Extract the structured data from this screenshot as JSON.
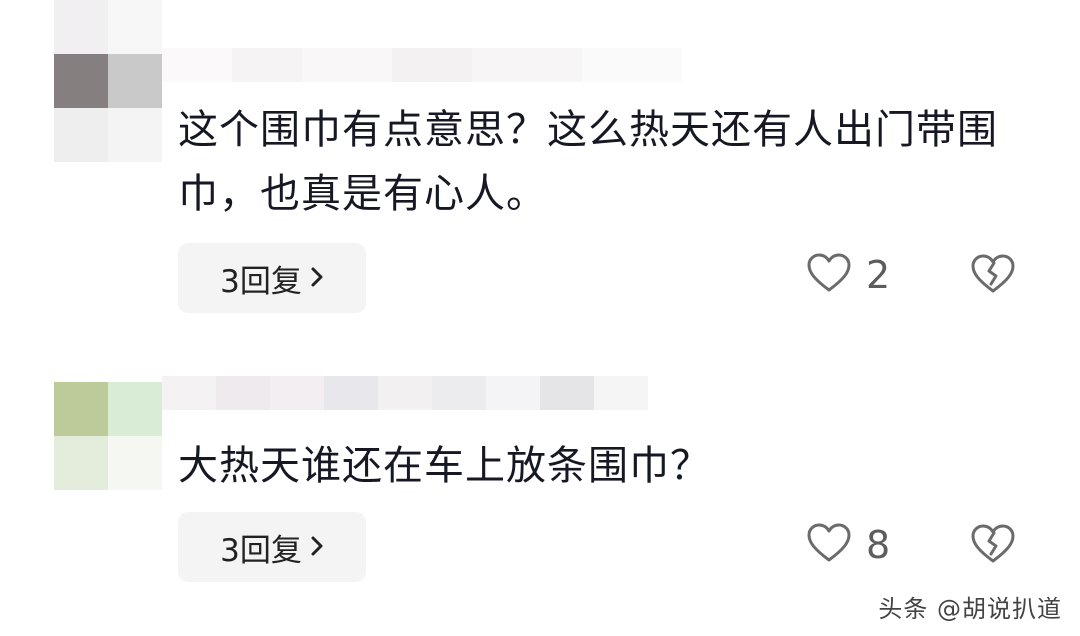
{
  "comments": [
    {
      "text": "这个围巾有点意思？这么热天还有人出门带围巾，也真是有心人。",
      "reply_label": "3回复",
      "like_count": "2"
    },
    {
      "text": "大热天谁还在车上放条围巾？",
      "reply_label": "3回复",
      "like_count": "8"
    }
  ],
  "icons": {
    "reply_chevron": "chevron-right-icon",
    "like": "heart-outline-icon",
    "dislike": "broken-heart-icon"
  },
  "colors": {
    "icon_stroke": "#6b6b6b",
    "reply_bg": "#f4f4f4"
  },
  "watermark": "头条 @胡说扒道"
}
